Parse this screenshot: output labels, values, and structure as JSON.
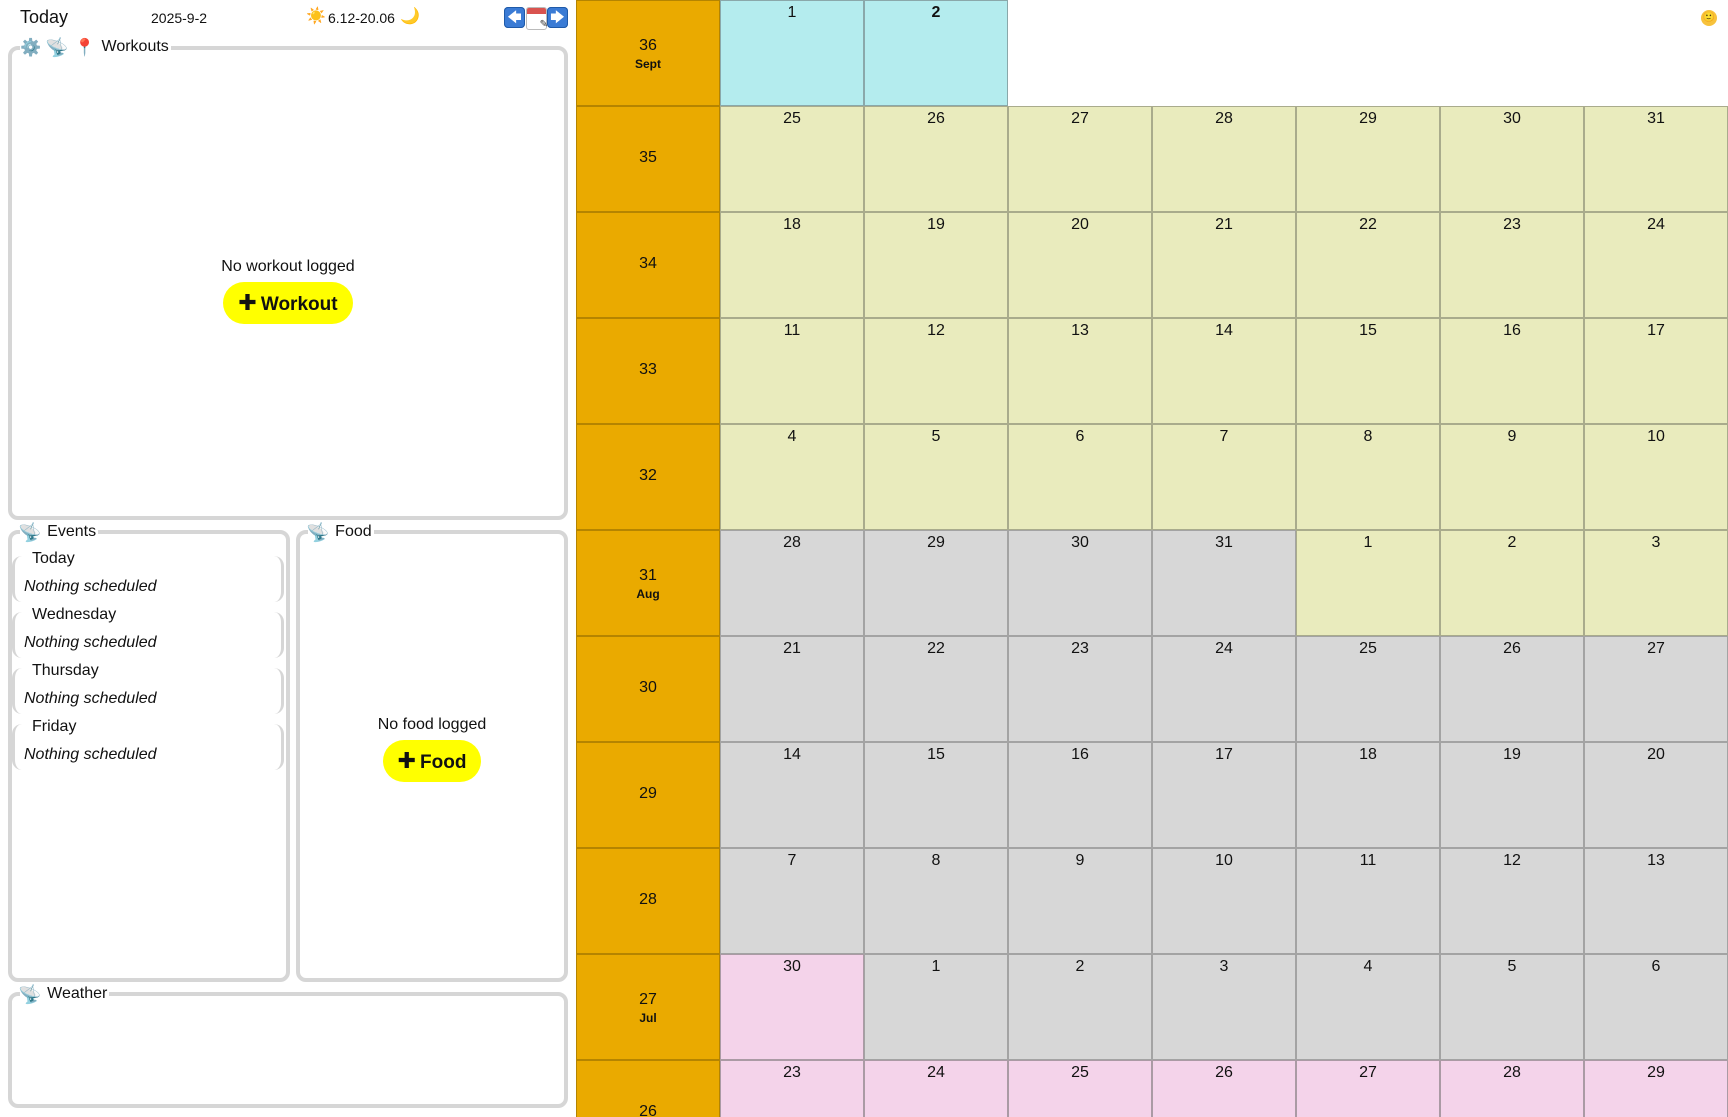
{
  "header": {
    "title": "Today",
    "date": "2025-9-2",
    "sun_icon": "☀️",
    "sun_range": "6.12-20.06",
    "moon_icon": "🌙",
    "prev_icon": "🡄",
    "next_icon": "🡆"
  },
  "workouts": {
    "title": "Workouts",
    "empty_text": "No workout logged",
    "add_label": "Workout",
    "icons": [
      "gear-icon",
      "satellite-icon",
      "pin-icon"
    ]
  },
  "events": {
    "title": "Events",
    "items": [
      {
        "day": "Today",
        "text": "Nothing scheduled"
      },
      {
        "day": "Wednesday",
        "text": "Nothing scheduled"
      },
      {
        "day": "Thursday",
        "text": "Nothing scheduled"
      },
      {
        "day": "Friday",
        "text": "Nothing scheduled"
      }
    ]
  },
  "food": {
    "title": "Food",
    "empty_text": "No food logged",
    "add_label": "Food"
  },
  "weather": {
    "title": "Weather"
  },
  "calendar": {
    "colors": {
      "current": "#b4ecee",
      "august": "#e9ebbd",
      "july": "#d7d7d7",
      "june": "#f4d3ea",
      "week": "#eaaa00"
    },
    "weeks": [
      {
        "week": "36",
        "month": "Sept",
        "days": [
          {
            "d": "1",
            "p": "current"
          },
          {
            "d": "2",
            "p": "current",
            "bold": true
          }
        ]
      },
      {
        "week": "35",
        "month": "",
        "days": [
          {
            "d": "25",
            "p": "aug"
          },
          {
            "d": "26",
            "p": "aug"
          },
          {
            "d": "27",
            "p": "aug"
          },
          {
            "d": "28",
            "p": "aug"
          },
          {
            "d": "29",
            "p": "aug"
          },
          {
            "d": "30",
            "p": "aug"
          },
          {
            "d": "31",
            "p": "aug"
          }
        ]
      },
      {
        "week": "34",
        "month": "",
        "days": [
          {
            "d": "18",
            "p": "aug"
          },
          {
            "d": "19",
            "p": "aug"
          },
          {
            "d": "20",
            "p": "aug"
          },
          {
            "d": "21",
            "p": "aug"
          },
          {
            "d": "22",
            "p": "aug"
          },
          {
            "d": "23",
            "p": "aug"
          },
          {
            "d": "24",
            "p": "aug"
          }
        ]
      },
      {
        "week": "33",
        "month": "",
        "days": [
          {
            "d": "11",
            "p": "aug"
          },
          {
            "d": "12",
            "p": "aug"
          },
          {
            "d": "13",
            "p": "aug"
          },
          {
            "d": "14",
            "p": "aug"
          },
          {
            "d": "15",
            "p": "aug"
          },
          {
            "d": "16",
            "p": "aug"
          },
          {
            "d": "17",
            "p": "aug"
          }
        ]
      },
      {
        "week": "32",
        "month": "",
        "days": [
          {
            "d": "4",
            "p": "aug"
          },
          {
            "d": "5",
            "p": "aug"
          },
          {
            "d": "6",
            "p": "aug"
          },
          {
            "d": "7",
            "p": "aug"
          },
          {
            "d": "8",
            "p": "aug"
          },
          {
            "d": "9",
            "p": "aug"
          },
          {
            "d": "10",
            "p": "aug"
          }
        ]
      },
      {
        "week": "31",
        "month": "Aug",
        "days": [
          {
            "d": "28",
            "p": "jul"
          },
          {
            "d": "29",
            "p": "jul"
          },
          {
            "d": "30",
            "p": "jul"
          },
          {
            "d": "31",
            "p": "jul"
          },
          {
            "d": "1",
            "p": "aug"
          },
          {
            "d": "2",
            "p": "aug"
          },
          {
            "d": "3",
            "p": "aug"
          }
        ]
      },
      {
        "week": "30",
        "month": "",
        "days": [
          {
            "d": "21",
            "p": "jul"
          },
          {
            "d": "22",
            "p": "jul"
          },
          {
            "d": "23",
            "p": "jul"
          },
          {
            "d": "24",
            "p": "jul"
          },
          {
            "d": "25",
            "p": "jul"
          },
          {
            "d": "26",
            "p": "jul"
          },
          {
            "d": "27",
            "p": "jul"
          }
        ]
      },
      {
        "week": "29",
        "month": "",
        "days": [
          {
            "d": "14",
            "p": "jul"
          },
          {
            "d": "15",
            "p": "jul"
          },
          {
            "d": "16",
            "p": "jul"
          },
          {
            "d": "17",
            "p": "jul"
          },
          {
            "d": "18",
            "p": "jul"
          },
          {
            "d": "19",
            "p": "jul"
          },
          {
            "d": "20",
            "p": "jul"
          }
        ]
      },
      {
        "week": "28",
        "month": "",
        "days": [
          {
            "d": "7",
            "p": "jul"
          },
          {
            "d": "8",
            "p": "jul"
          },
          {
            "d": "9",
            "p": "jul"
          },
          {
            "d": "10",
            "p": "jul"
          },
          {
            "d": "11",
            "p": "jul"
          },
          {
            "d": "12",
            "p": "jul"
          },
          {
            "d": "13",
            "p": "jul"
          }
        ]
      },
      {
        "week": "27",
        "month": "Jul",
        "days": [
          {
            "d": "30",
            "p": "jun"
          },
          {
            "d": "1",
            "p": "jul"
          },
          {
            "d": "2",
            "p": "jul"
          },
          {
            "d": "3",
            "p": "jul"
          },
          {
            "d": "4",
            "p": "jul"
          },
          {
            "d": "5",
            "p": "jul"
          },
          {
            "d": "6",
            "p": "jul"
          }
        ]
      },
      {
        "week": "26",
        "month": "",
        "days": [
          {
            "d": "23",
            "p": "jun"
          },
          {
            "d": "24",
            "p": "jun"
          },
          {
            "d": "25",
            "p": "jun"
          },
          {
            "d": "26",
            "p": "jun"
          },
          {
            "d": "27",
            "p": "jun"
          },
          {
            "d": "28",
            "p": "jun"
          },
          {
            "d": "29",
            "p": "jun"
          }
        ]
      }
    ]
  },
  "status_icon": "🙂"
}
